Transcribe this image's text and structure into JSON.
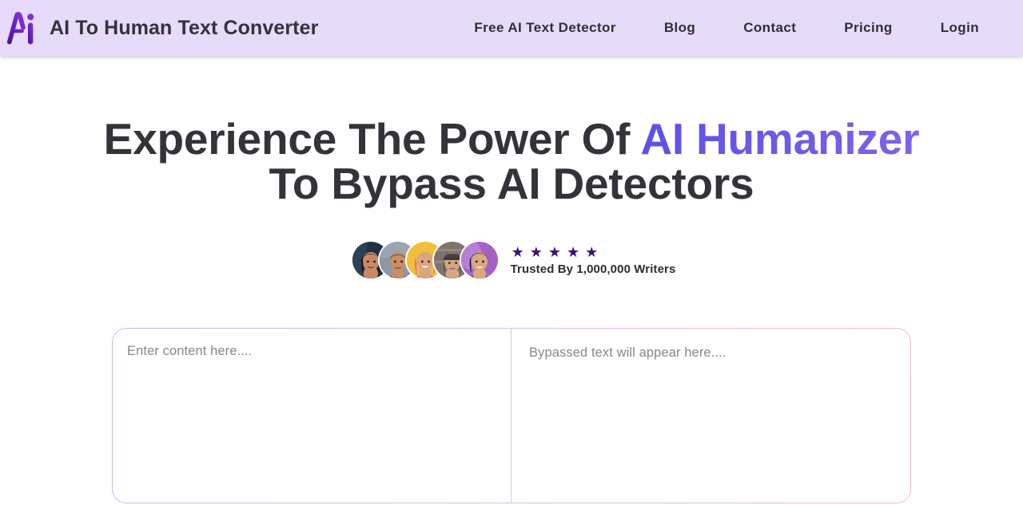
{
  "header": {
    "logo_icon": "ai-logo-icon",
    "brand_title": "AI To Human Text Converter",
    "nav": [
      {
        "label": "Free AI Text Detector",
        "name": "nav-free-ai-text-detector"
      },
      {
        "label": "Blog",
        "name": "nav-blog"
      },
      {
        "label": "Contact",
        "name": "nav-contact"
      },
      {
        "label": "Pricing",
        "name": "nav-pricing"
      },
      {
        "label": "Login",
        "name": "nav-login"
      }
    ],
    "background_color": "#e6dbf8"
  },
  "hero": {
    "title_part1": "Experience The Power Of ",
    "title_accent": "AI Humanizer",
    "title_part2": " To Bypass AI Detectors",
    "accent_color": "#6056e6",
    "heading_color": "#33333a"
  },
  "trust": {
    "star_count": 5,
    "star_glyph": "★",
    "star_color": "#3b1270",
    "caption": "Trusted By 1,000,000 Writers",
    "avatars": [
      {
        "name": "avatar-writer-1",
        "bg": "#1e3244",
        "skin": "#c98a63",
        "hair": "#1b1410",
        "shirt": "#c0305a"
      },
      {
        "name": "avatar-writer-2",
        "bg": "#8d98a6",
        "skin": "#c58f68",
        "hair": "#3a3128",
        "shirt": "#2e6c86"
      },
      {
        "name": "avatar-writer-3",
        "bg": "#f0c03c",
        "skin": "#dca581",
        "hair": "#e9748a",
        "shirt": "#d63a47"
      },
      {
        "name": "avatar-writer-4",
        "bg": "#8b7f78",
        "skin": "#d6a585",
        "hair": "#4a4440",
        "shirt": "#69788c"
      },
      {
        "name": "avatar-writer-5",
        "bg": "#a561c4",
        "skin": "#d9a87f",
        "hair": "#2a1a2e",
        "shirt": "#4b3a55"
      }
    ]
  },
  "editor": {
    "input_placeholder": "Enter content here....",
    "output_placeholder": "Bypassed text will appear here....",
    "border_gradient_start": "#c6bce6",
    "border_gradient_end": "#eab6d6",
    "divider_color": "#d4cbe8"
  }
}
